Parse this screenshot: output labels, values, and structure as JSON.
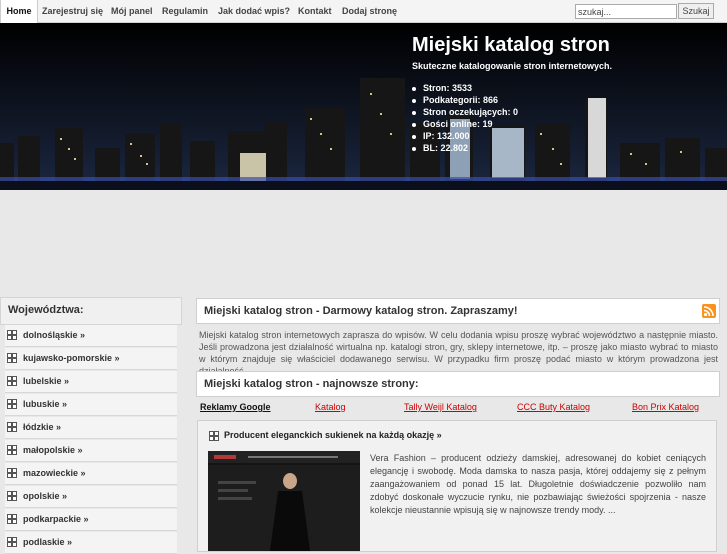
{
  "nav": {
    "items": [
      "Home",
      "Zarejestruj się",
      "Mój panel",
      "Regulamin",
      "Jak dodać wpis?",
      "Kontakt",
      "Dodaj stronę"
    ],
    "active_index": 0,
    "search_value": "szukaj...",
    "search_button": "Szukaj"
  },
  "header": {
    "title": "Miejski katalog stron",
    "subtitle": "Skuteczne katalogowanie stron internetowych.",
    "stats": [
      "Stron: 3533",
      "Podkategorii: 866",
      "Stron oczekujących: 0",
      "Gości online: 19",
      "IP: 132.000",
      "BL: 22.802"
    ]
  },
  "sidebar": {
    "heading": "Województwa:",
    "items": [
      "dolnośląskie »",
      "kujawsko-pomorskie »",
      "lubelskie »",
      "lubuskie »",
      "łódzkie »",
      "małopolskie »",
      "mazowieckie »",
      "opolskie »",
      "podkarpackie »",
      "podlaskie »"
    ]
  },
  "main": {
    "intro_title": "Miejski katalog stron - Darmowy katalog stron. Zapraszamy!",
    "rss_icon": "rss-icon",
    "intro_text": "Miejski katalog stron internetowych zaprasza do wpisów. W celu dodania wpisu proszę wybrać województwo a następnie miasto. Jeśli prowadzona jest działalność wirtualna np. katalogi stron, gry, sklepy internetowe, itp. – proszę jako miasto wybrać to miasto w którym znajduje się właściciel dodawanego serwisu. W przypadku firm proszę podać miasto w którym prowadzona jest działalność.",
    "newest_title": "Miejski katalog stron - najnowsze strony:",
    "links": [
      "Reklamy Google",
      "Katalog",
      "Tally Weijl Katalog",
      "CCC Buty Katalog",
      "Bon Prix Katalog"
    ],
    "entry": {
      "title": "Producent eleganckich sukienek na każdą okazję »",
      "description": "Vera Fashion – producent odzieży damskiej, adresowanej do kobiet ceniących elegancję i swobodę. Moda damska to nasza pasja, której oddajemy się z pełnym zaangażowaniem od ponad 15 lat. Długoletnie doświadczenie pozwoliło nam zdobyć doskonałe wyczucie rynku, nie pozbawiając świeżości spojrzenia - nasze kolekcje nieustannie wpisują się w najnowsze trendy mody. ..."
    }
  },
  "colors": {
    "accent_red": "#cc0000",
    "banner_bg": "#000000",
    "rss_orange": "#f7931e"
  }
}
